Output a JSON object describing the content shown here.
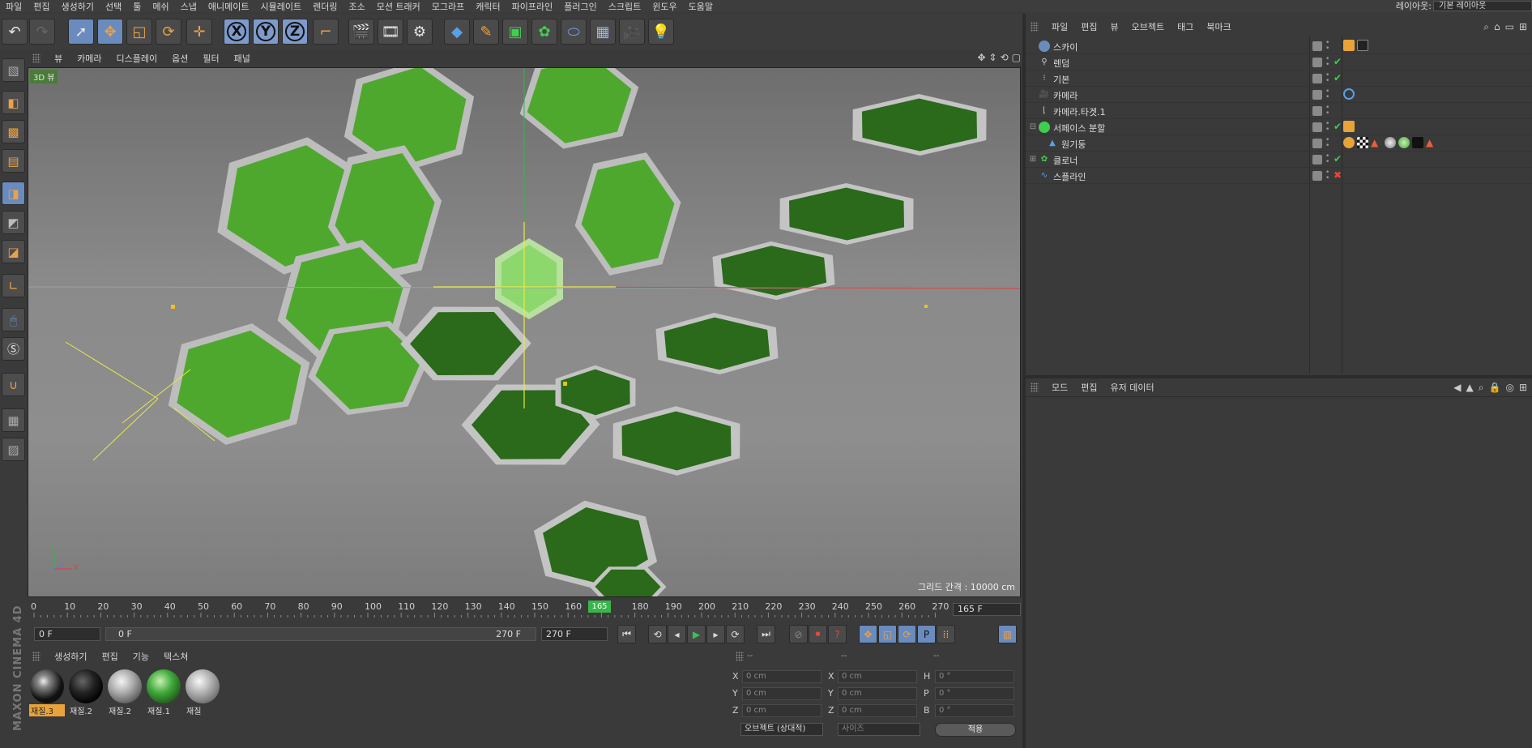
{
  "menubar": {
    "items": [
      "파일",
      "편집",
      "생성하기",
      "선택",
      "툴",
      "메쉬",
      "스냅",
      "애니메이트",
      "시뮬레이트",
      "렌더링",
      "조소",
      "모션 트래커",
      "모그라프",
      "캐릭터",
      "파이프라인",
      "플러그인",
      "스크립트",
      "윈도우",
      "도움말"
    ],
    "layout_label": "레이아웃:",
    "layout_value": "기본 레이아웃"
  },
  "toolbar": {
    "axis_x": "X",
    "axis_y": "Y",
    "axis_z": "Z"
  },
  "viewport": {
    "menu": [
      "뷰",
      "카메라",
      "디스플레이",
      "옵션",
      "필터",
      "패널"
    ],
    "label": "3D 뷰",
    "grid_text": "그리드 간격 : 10000 cm",
    "axis_y": "Y",
    "axis_x": "X"
  },
  "timeline": {
    "ticks": [
      "0",
      "10",
      "20",
      "30",
      "40",
      "50",
      "60",
      "70",
      "80",
      "90",
      "100",
      "110",
      "120",
      "130",
      "140",
      "150",
      "160",
      "165",
      "180",
      "190",
      "200",
      "210",
      "220",
      "230",
      "240",
      "250",
      "260",
      "270"
    ],
    "current_frame_marker": "165",
    "current_frame_field": "165 F"
  },
  "controls": {
    "start": "0 F",
    "range_start": "0 F",
    "range_end": "270 F",
    "end": "270 F"
  },
  "materials": {
    "menu": [
      "생성하기",
      "편집",
      "기능",
      "텍스쳐"
    ],
    "items": [
      {
        "label": "재질.3",
        "selected": true,
        "color": "#222222"
      },
      {
        "label": "재질.2",
        "selected": false,
        "color": "#111111"
      },
      {
        "label": "재질.2",
        "selected": false,
        "color": "#9a9a9a"
      },
      {
        "label": "재질.1",
        "selected": false,
        "color": "#3fa83a"
      },
      {
        "label": "재질",
        "selected": false,
        "color": "#a8a8a8"
      }
    ]
  },
  "coords": {
    "headers": [
      "--",
      "--",
      "--"
    ],
    "rows": [
      {
        "l1": "X",
        "v1": "0 cm",
        "l2": "X",
        "v2": "0 cm",
        "l3": "H",
        "v3": "0 °"
      },
      {
        "l1": "Y",
        "v1": "0 cm",
        "l2": "Y",
        "v2": "0 cm",
        "l3": "P",
        "v3": "0 °"
      },
      {
        "l1": "Z",
        "v1": "0 cm",
        "l2": "Z",
        "v2": "0 cm",
        "l3": "B",
        "v3": "0 °"
      }
    ],
    "mode_select": "오브젝트 (상대적)",
    "size_select": "사이즈",
    "apply": "적용"
  },
  "object_manager": {
    "menu": [
      "파일",
      "편집",
      "뷰",
      "오브젝트",
      "태그",
      "북마크"
    ],
    "objects": [
      {
        "name": "스카이",
        "status": "none"
      },
      {
        "name": "렌덤",
        "status": "check"
      },
      {
        "name": "기본",
        "status": "check"
      },
      {
        "name": "카메라",
        "status": "none"
      },
      {
        "name": "카메라.타겟.1",
        "status": "none"
      },
      {
        "name": "서페이스 분할",
        "status": "check"
      },
      {
        "name": "원기둥",
        "status": "none"
      },
      {
        "name": "클로너",
        "status": "check"
      },
      {
        "name": "스플라인",
        "status": "x"
      }
    ]
  },
  "attributes": {
    "menu": [
      "모드",
      "편집",
      "유저 데이터"
    ]
  },
  "colors": {
    "accent_blue": "#6a8bbd",
    "hex_light_green": "#4fa82e",
    "hex_dark_green": "#2a6a1a",
    "selected_material": "#e8a33a",
    "ok_green": "#3fcf4f",
    "error_red": "#e8473a"
  }
}
